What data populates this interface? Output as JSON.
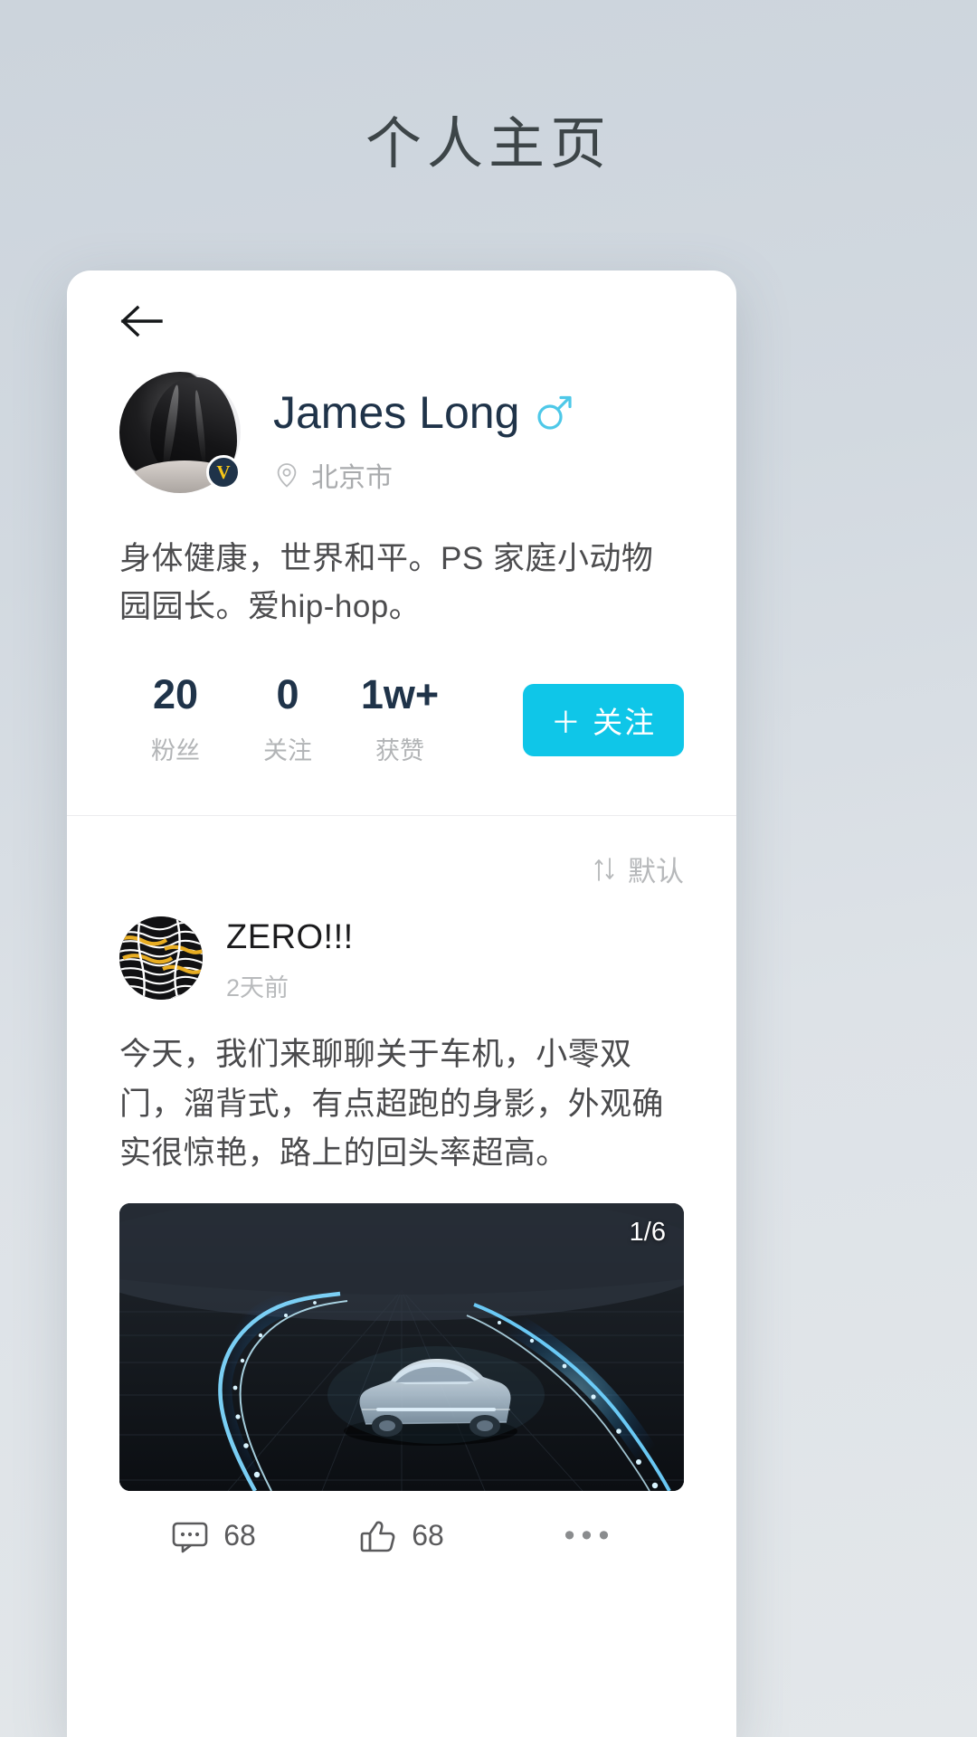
{
  "page": {
    "title": "个人主页"
  },
  "nav": {
    "back_icon": "arrow-left-icon"
  },
  "profile": {
    "avatar_alt": "user-avatar",
    "verified_badge": "V",
    "display_name": "James Long",
    "gender_icon": "male-gender-icon",
    "location_icon": "location-pin-icon",
    "location": "北京市",
    "bio": "身体健康，世界和平。PS 家庭小动物园园长。爱hip-hop。",
    "stats": [
      {
        "value": "20",
        "label": "粉丝"
      },
      {
        "value": "0",
        "label": "关注"
      },
      {
        "value": "1w+",
        "label": "获赞"
      }
    ],
    "follow_button": "＋ 关注"
  },
  "feed": {
    "sort_icon": "sort-arrows-icon",
    "sort_label": "默认",
    "posts": [
      {
        "author": "ZERO!!!",
        "author_avatar_alt": "zero-logo-avatar",
        "time": "2天前",
        "text": "今天，我们来聊聊关于车机，小零双门，溜背式，有点超跑的身影，外观确实很惊艳，路上的回头率超高。",
        "media_counter": "1/6",
        "media_alt": "concept-car-on-light-trail-road",
        "actions": {
          "comment_icon": "comment-bubble-icon",
          "comment_count": "68",
          "like_icon": "thumbs-up-icon",
          "like_count": "68",
          "more_icon": "more-dots-icon",
          "more_label": "•••"
        }
      }
    ]
  },
  "colors": {
    "accent": "#0fc6e8",
    "name_text": "#1f3349",
    "badge_bg": "#1f3349",
    "badge_fg": "#f5c518",
    "gender": "#4ec8e8"
  }
}
